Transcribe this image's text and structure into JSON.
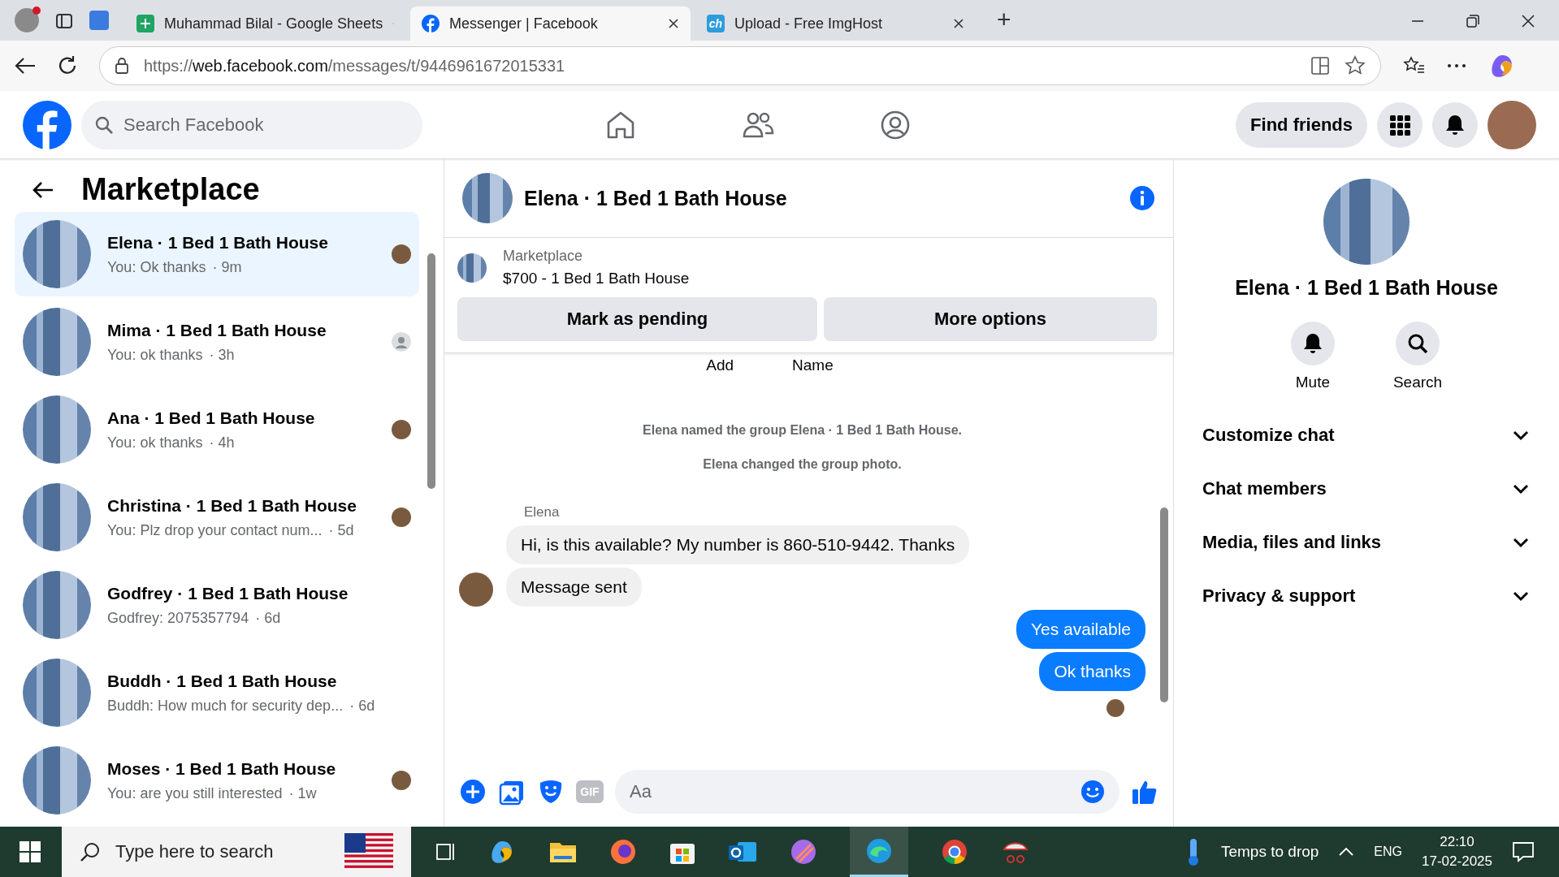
{
  "browser": {
    "tabs": [
      {
        "title": "Muhammad Bilal - Google Sheets",
        "kind": "sheets",
        "selected": false
      },
      {
        "title": "Messenger | Facebook",
        "kind": "facebook",
        "selected": true
      },
      {
        "title": "Upload - Free ImgHost",
        "kind": "ch",
        "selected": false
      }
    ],
    "ch_logo": "ch",
    "new_tab": "+",
    "url": {
      "scheme": "https://",
      "domain": "web.facebook.com",
      "path": "/messages/t/9446961672015331"
    }
  },
  "facebook_header": {
    "search": {
      "placeholder": "Search Facebook"
    },
    "find_friends": "Find friends"
  },
  "sidebar": {
    "title": "Marketplace",
    "conversations": [
      {
        "title": "Elena · 1 Bed 1 Bath House",
        "preview": "You: Ok thanks",
        "time": "· 9m",
        "kind": "seen-photo",
        "selected": true
      },
      {
        "title": "Mima · 1 Bed 1 Bath House",
        "preview": "You: ok thanks",
        "time": "· 3h",
        "kind": "seen-silhouette",
        "selected": false
      },
      {
        "title": "Ana · 1 Bed 1 Bath House",
        "preview": "You: ok thanks",
        "time": "· 4h",
        "kind": "seen-photo",
        "selected": false
      },
      {
        "title": "Christina · 1 Bed 1 Bath House",
        "preview": "You: Plz drop your contact num...",
        "time": "· 5d",
        "kind": "seen-photo",
        "selected": false
      },
      {
        "title": "Godfrey · 1 Bed 1 Bath House",
        "preview": "Godfrey: 2075357794",
        "time": "· 6d",
        "kind": "unseen",
        "selected": false
      },
      {
        "title": "Buddh · 1 Bed 1 Bath House",
        "preview": "Buddh: How much for security dep...",
        "time": "· 6d",
        "kind": "unseen",
        "selected": false
      },
      {
        "title": "Moses · 1 Bed 1 Bath House",
        "preview": "You: are you still interested",
        "time": "· 1w",
        "kind": "seen-photo",
        "selected": false
      }
    ]
  },
  "chat": {
    "title": "Elena · 1 Bed 1 Bath House",
    "listing": {
      "label": "Marketplace",
      "item": "$700 - 1 Bed 1 Bath House",
      "buttons": [
        "Mark as pending",
        "More options"
      ]
    },
    "scrolled_labels": [
      "Add",
      "Name"
    ],
    "events": [
      "Elena named the group Elena · 1 Bed 1 Bath House.",
      "Elena changed the group photo."
    ],
    "sender": "Elena",
    "messages": [
      {
        "kind": "incoming",
        "text": "Hi, is this available? My number is 860-510-9442. Thanks"
      },
      {
        "kind": "incoming",
        "text": "Message sent"
      },
      {
        "kind": "outgoing",
        "text": "Yes available"
      },
      {
        "kind": "outgoing",
        "text": "Ok thanks"
      }
    ],
    "composer": {
      "placeholder": "Aa",
      "gif": "GIF"
    }
  },
  "details": {
    "name": "Elena · 1 Bed 1 Bath House",
    "actions": [
      {
        "kind": "bell",
        "label": "Mute"
      },
      {
        "kind": "search",
        "label": "Search"
      }
    ],
    "sections": [
      "Customize chat",
      "Chat members",
      "Media, files and links",
      "Privacy & support"
    ]
  },
  "taskbar": {
    "search": {
      "placeholder": "Type here to search"
    },
    "weather": "Temps to drop",
    "language": "ENG",
    "time": "22:10",
    "date": "17-02-2025"
  }
}
